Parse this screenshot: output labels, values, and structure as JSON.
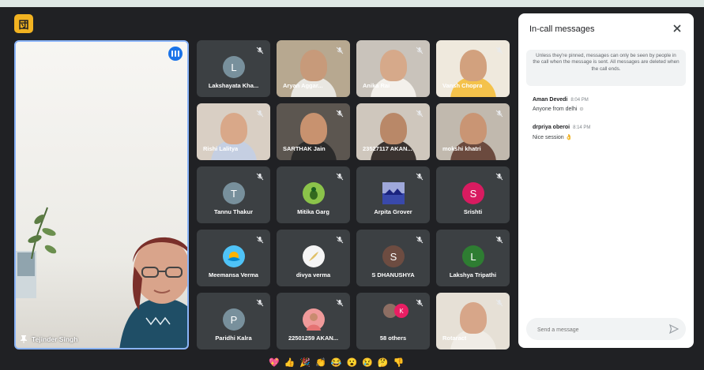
{
  "app": {
    "badge": "団"
  },
  "main_speaker": {
    "name": "Tejinder Singh"
  },
  "tiles": [
    {
      "name": "Lakshayata Kha...",
      "type": "avatar",
      "initial": "L",
      "color": "#78909c"
    },
    {
      "name": "Aryan Aggar...",
      "type": "video",
      "bg": "#b7a890",
      "skin": "#c79a7a",
      "shirt": "#e9e7e2"
    },
    {
      "name": "Anika Rai",
      "type": "video",
      "bg": "#c9c3bb",
      "skin": "#d6a98a",
      "shirt": "#f3f0eb"
    },
    {
      "name": "Vansh Chopra",
      "type": "video",
      "bg": "#efe9dd",
      "skin": "#d2a17e",
      "shirt": "#f4c24b"
    },
    {
      "name": "Rishi Lalitya",
      "type": "video",
      "bg": "#d9cfc4",
      "skin": "#d9a889",
      "shirt": "#c5cfe2"
    },
    {
      "name": "SARTHAK Jain",
      "type": "video",
      "bg": "#5c5650",
      "skin": "#c8926f",
      "shirt": "#2b2b2b"
    },
    {
      "name": "23527117 AKAN...",
      "type": "video",
      "bg": "#cfc7bd",
      "skin": "#b98868",
      "shirt": "#3a3330"
    },
    {
      "name": "mokshi khatri",
      "type": "video",
      "bg": "#c1b9ae",
      "skin": "#c99574",
      "shirt": "#6b4a3e"
    },
    {
      "name": "Tannu Thakur",
      "type": "avatar",
      "initial": "T",
      "color": "#78909c"
    },
    {
      "name": "Mitika Garg",
      "type": "avatar",
      "initial": "",
      "color": "#8bc34a",
      "picture": "bird"
    },
    {
      "name": "Arpita Grover",
      "type": "avatar",
      "initial": "",
      "color": "#5c6bc0",
      "picture": "landscape"
    },
    {
      "name": "Srishti",
      "type": "avatar",
      "initial": "S",
      "color": "#d81b60"
    },
    {
      "name": "Meemansa Verma",
      "type": "avatar",
      "initial": "",
      "color": "#4fc3f7",
      "picture": "sun"
    },
    {
      "name": "divya verma",
      "type": "avatar",
      "initial": "",
      "color": "#f5f5f5",
      "picture": "feather"
    },
    {
      "name": "S DHANUSHYA",
      "type": "avatar",
      "initial": "S",
      "color": "#6d4c41"
    },
    {
      "name": "Lakshya Tripathi",
      "type": "avatar",
      "initial": "L",
      "color": "#2e7d32"
    },
    {
      "name": "Paridhi Kalra",
      "type": "avatar",
      "initial": "P",
      "color": "#78909c"
    },
    {
      "name": "22501259 AKAN...",
      "type": "avatar",
      "initial": "",
      "color": "#ef9a9a",
      "picture": "portrait"
    },
    {
      "name": "58 others",
      "type": "others",
      "initial": "K",
      "color": "#e91e63"
    },
    {
      "name": "Rotaract",
      "type": "video",
      "bg": "#e6e0d6",
      "skin": "#d7a689",
      "shirt": "#f0ece6"
    }
  ],
  "chat": {
    "title": "In-call messages",
    "notice": "Unless they're pinned, messages can only be seen by people in the call when the message is sent. All messages are deleted when the call ends.",
    "messages": [
      {
        "sender": "Aman Devedi",
        "time": "8:04 PM",
        "text": "Anyone from delhi ☺"
      },
      {
        "sender": "drpriya oberoi",
        "time": "8:14 PM",
        "text": "Nice session 👌"
      }
    ],
    "input_placeholder": "Send a message"
  },
  "reactions": [
    "💖",
    "👍",
    "🎉",
    "👏",
    "😂",
    "😮",
    "😢",
    "🤔",
    "👎"
  ],
  "colors": {
    "background": "#202124",
    "tile": "#3c4043",
    "accent": "#8ab4f8",
    "speaking": "#1a73e8"
  }
}
